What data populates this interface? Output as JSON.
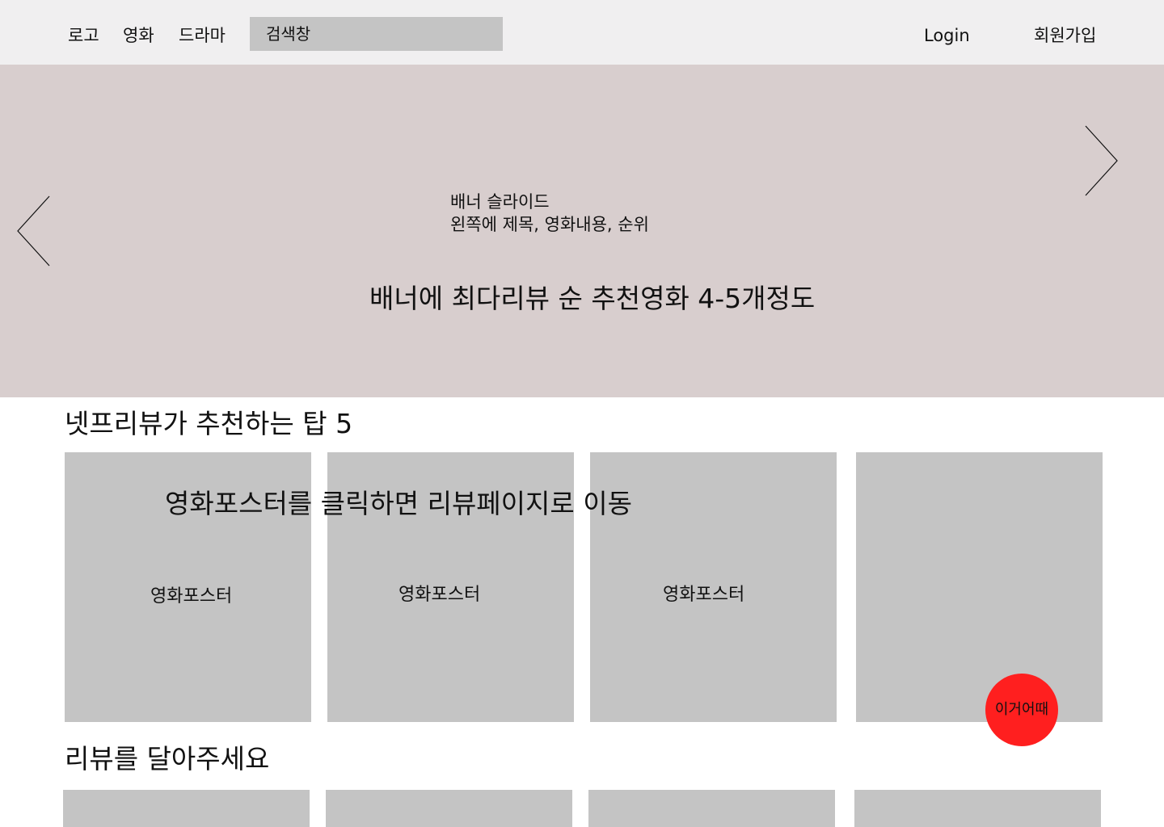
{
  "header": {
    "nav": [
      "로고",
      "영화",
      "드라마"
    ],
    "search": {
      "value": "검색창"
    },
    "login": "Login",
    "signup": "회원가입"
  },
  "banner": {
    "slide_label": "배너 슬라이드",
    "slide_note": "왼쪽에 제목, 영화내용, 순위",
    "main_note": "배너에 최다리뷰 순 추천영화 4-5개정도",
    "prev_icon": "chevron-left-icon",
    "next_icon": "chevron-right-icon"
  },
  "top5": {
    "title": "넷프리뷰가 추천하는 탑 5",
    "overlay_note": "영화포스터를 클릭하면 리뷰페이지로 이동",
    "posters": [
      "영화포스터",
      "영화포스터",
      "영화포스터",
      ""
    ],
    "badge": "이거어때"
  },
  "review": {
    "title": "리뷰를 달아주세요"
  },
  "colors": {
    "header_bg": "#f0eff0",
    "banner_bg": "#d8cece",
    "placeholder_gray": "#c4c4c4",
    "badge_red": "#ff1f1f"
  }
}
